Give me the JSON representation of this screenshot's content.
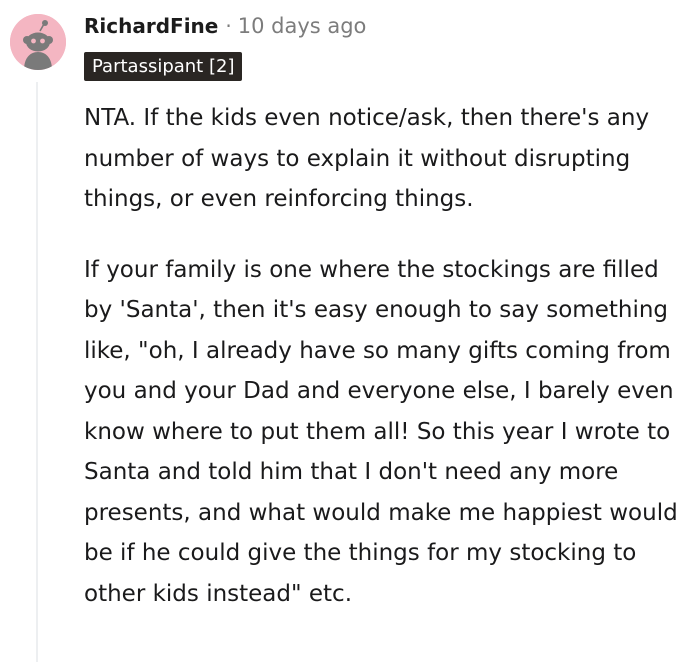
{
  "comment": {
    "author": "RichardFine",
    "separator": "·",
    "timestamp": "10 days ago",
    "flair": "Partassipant [2]",
    "avatar_icon": "snoo-avatar-icon",
    "avatar_color": "#f4b6c2",
    "paragraphs": [
      "NTA. If the kids even notice/ask, then there's any number of ways to explain it without disrupting things, or even reinforcing things.",
      "If your family is one where the stockings are filled by 'Santa', then it's easy enough to say something like, \"oh, I already have so many gifts coming from you and your Dad and everyone else, I barely even know where to put them all! So this year I wrote to Santa and told him that I don't need any more presents, and what would make me happiest would be if he could give the things for my stocking to other kids instead\" etc."
    ]
  },
  "colors": {
    "text": "#1a1a1b",
    "meta": "#7c7c7c",
    "flair_bg": "#2a2623",
    "flair_text": "#ffffff",
    "thread_line": "#edeff1"
  }
}
